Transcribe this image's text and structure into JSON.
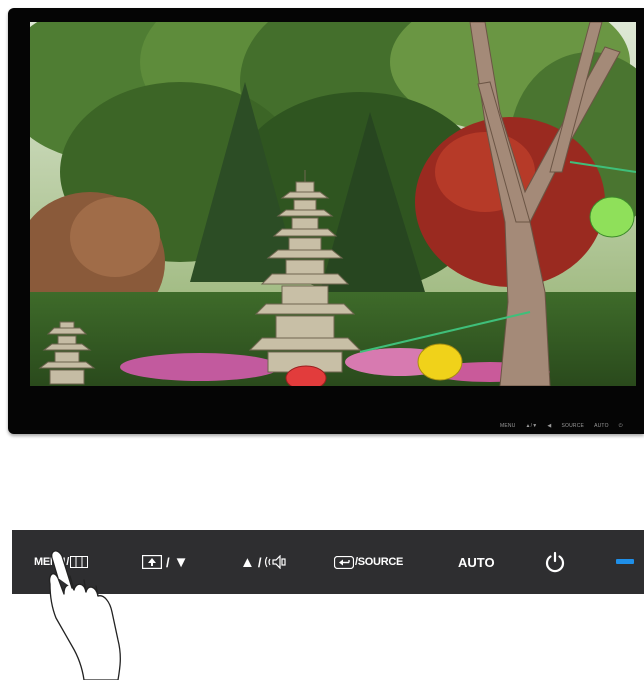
{
  "controls": {
    "menu_label": "MENU",
    "menu_icon": "grid-icon",
    "brightness_label": "/",
    "brightness_icon": "brightness-box-icon",
    "down_arrow": "▼",
    "up_arrow": "▲",
    "volume_label": "/",
    "volume_icon": "speaker-icon",
    "source_icon": "input-arrow-icon",
    "source_label": "/SOURCE",
    "auto_label": "AUTO",
    "power_icon": "power-icon",
    "indicator_icon": "power-led-icon"
  },
  "monitor": {
    "screen_content": "garden-pagoda-photo",
    "bezel_labels": [
      "MENU",
      "▲/▼",
      "◀",
      "SOURCE",
      "AUTO",
      "⏻"
    ]
  },
  "colors": {
    "panel": "#2e2e30",
    "led": "#1f8fe8",
    "bezel": "#050505"
  }
}
